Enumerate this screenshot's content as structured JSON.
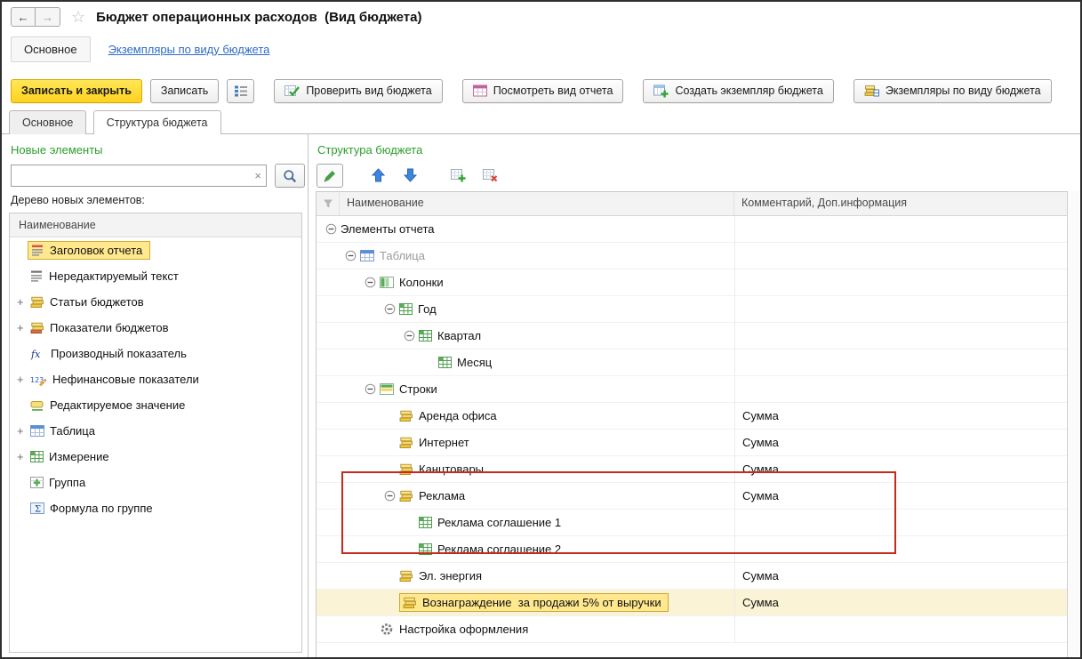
{
  "window": {
    "title": "Бюджет операционных расходов  (Вид бюджета)"
  },
  "nav": {
    "main_label": "Основное",
    "link": "Экземпляры по виду бюджета"
  },
  "command_bar": {
    "save_close": "Записать и закрыть",
    "save": "Записать",
    "check": "Проверить вид бюджета",
    "view_report": "Посмотреть вид отчета",
    "create_instance": "Создать экземпляр бюджета",
    "instances": "Экземпляры по виду бюджета"
  },
  "tabs": [
    {
      "label": "Основное",
      "active": false
    },
    {
      "label": "Структура бюджета",
      "active": true
    }
  ],
  "left_panel": {
    "title": "Новые элементы",
    "search_value": "",
    "clear_glyph": "×",
    "tree_label": "Дерево новых элементов:",
    "column_header": "Наименование",
    "items": [
      {
        "label": "Заголовок отчета",
        "icon": "report-title",
        "selected": true
      },
      {
        "label": "Нередактируемый текст",
        "icon": "static-text"
      },
      {
        "label": "Статьи бюджетов",
        "icon": "article",
        "expandable": true
      },
      {
        "label": "Показатели бюджетов",
        "icon": "indicator",
        "expandable": true
      },
      {
        "label": "Производный показатель",
        "icon": "fx"
      },
      {
        "label": "Нефинансовые показатели",
        "icon": "nonfinancial",
        "expandable": true
      },
      {
        "label": "Редактируемое значение",
        "icon": "editable-value"
      },
      {
        "label": "Таблица",
        "icon": "table-blue",
        "expandable": true
      },
      {
        "label": "Измерение",
        "icon": "dimension",
        "expandable": true
      },
      {
        "label": "Группа",
        "icon": "group"
      },
      {
        "label": "Формула по группе",
        "icon": "group-formula"
      }
    ]
  },
  "right_panel": {
    "title": "Структура бюджета",
    "columns": [
      "Наименование",
      "Комментарий, Доп.информация"
    ],
    "rows": [
      {
        "level": 0,
        "expander": "minus",
        "label": "Элементы отчета",
        "icon": "none",
        "comment": ""
      },
      {
        "level": 1,
        "expander": "minus",
        "label": "Таблица",
        "icon": "table-blue",
        "muted": true,
        "comment": ""
      },
      {
        "level": 2,
        "expander": "minus",
        "label": "Колонки",
        "icon": "columns",
        "comment": ""
      },
      {
        "level": 3,
        "expander": "minus",
        "label": "Год",
        "icon": "dimension",
        "comment": ""
      },
      {
        "level": 4,
        "expander": "minus",
        "label": "Квартал",
        "icon": "dimension",
        "comment": ""
      },
      {
        "level": 5,
        "expander": "none",
        "label": "Месяц",
        "icon": "dimension",
        "comment": ""
      },
      {
        "level": 2,
        "expander": "minus",
        "label": "Строки",
        "icon": "rows",
        "comment": ""
      },
      {
        "level": 3,
        "expander": "none",
        "label": "Аренда офиса",
        "icon": "article",
        "comment": "Сумма"
      },
      {
        "level": 3,
        "expander": "none",
        "label": "Интернет",
        "icon": "article",
        "comment": "Сумма"
      },
      {
        "level": 3,
        "expander": "none",
        "label": "Канцтовары",
        "icon": "article",
        "comment": "Сумма"
      },
      {
        "level": 3,
        "expander": "minus",
        "label": "Реклама",
        "icon": "article",
        "comment": "Сумма",
        "in_highlight": true
      },
      {
        "level": 4,
        "expander": "none",
        "label": "Реклама соглашение 1",
        "icon": "dimension",
        "comment": "",
        "in_highlight": true
      },
      {
        "level": 4,
        "expander": "none",
        "label": "Реклама соглашение 2",
        "icon": "dimension",
        "comment": "",
        "in_highlight": true
      },
      {
        "level": 3,
        "expander": "none",
        "label": "Эл. энергия",
        "icon": "article",
        "comment": "Сумма"
      },
      {
        "level": 3,
        "expander": "none",
        "label": "Вознаграждение  за продажи 5% от выручки",
        "icon": "article",
        "comment": "Сумма",
        "selected": true
      },
      {
        "level": 2,
        "expander": "none",
        "label": "Настройка оформления",
        "icon": "gear",
        "comment": ""
      }
    ]
  },
  "colors": {
    "primary_button": "#ffd21e",
    "section_title": "#2b9e2b",
    "annotation": "#c52a1a",
    "selection_highlight": "#ffe88d",
    "link": "#2f6cc6"
  }
}
